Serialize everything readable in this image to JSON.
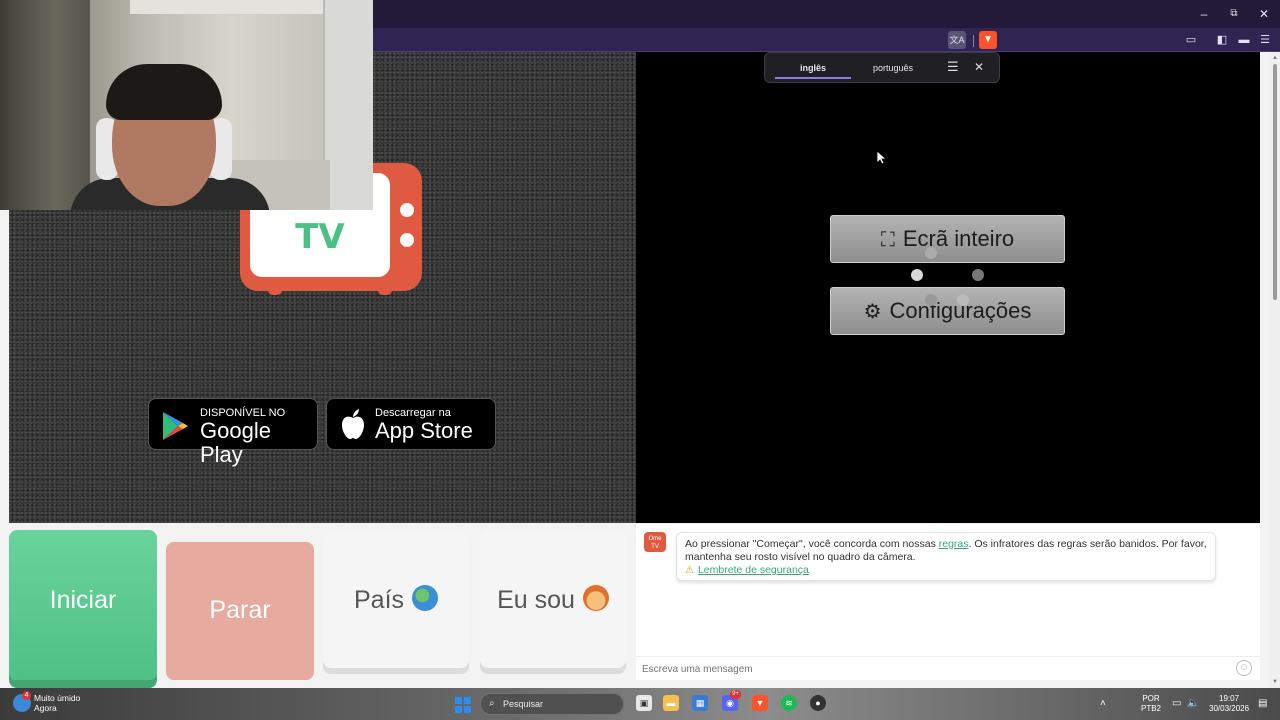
{
  "browser": {
    "window_controls": {
      "minimize": "–",
      "maximize": "⧉",
      "close": "✕"
    },
    "toolbar_icons": [
      "translate-icon",
      "brave-shield-icon",
      "sidebar-icon",
      "wallet-icon",
      "menu-icon"
    ]
  },
  "translate_popup": {
    "source_lang": "inglês",
    "target_lang": "português",
    "menu_icon": "hamburger-icon",
    "close_icon": "close-icon"
  },
  "logo": {
    "title": "Ome",
    "subtitle": "TV"
  },
  "stores": {
    "google": {
      "small": "DISPONÍVEL NO",
      "big": "Google Play"
    },
    "apple": {
      "small": "Descarregar na",
      "big": "App Store"
    }
  },
  "video_menu": {
    "fullscreen": "Ecrã inteiro",
    "settings": "Configurações"
  },
  "controls": {
    "start": "Iniciar",
    "stop": "Parar",
    "country": "País",
    "gender": "Eu sou"
  },
  "chat": {
    "logo_text": "Ome TV",
    "notice_pre": "Ao pressionar \"Começar\", você concorda com nossas ",
    "notice_link": "regras",
    "notice_post": ". Os infratores das regras serão banidos. Por favor, mantenha seu rosto visível no quadro da câmera.",
    "safety_link": "Lembrete de segurança",
    "input_placeholder": "Escreva uma mensagem"
  },
  "taskbar": {
    "weather_badge": "4",
    "weather_title": "Muito úmido",
    "weather_sub": "Agora",
    "search_label": "Pesquisar",
    "discord_badge": "9+",
    "lang_top": "POR",
    "lang_bottom": "PTB2",
    "time": "19:07",
    "date": "30/03/2026"
  },
  "colors": {
    "brand_red": "#e05a42",
    "brand_green": "#4bbf84",
    "start_green": "#5cc990",
    "stop_pink": "#e7aa9e"
  }
}
